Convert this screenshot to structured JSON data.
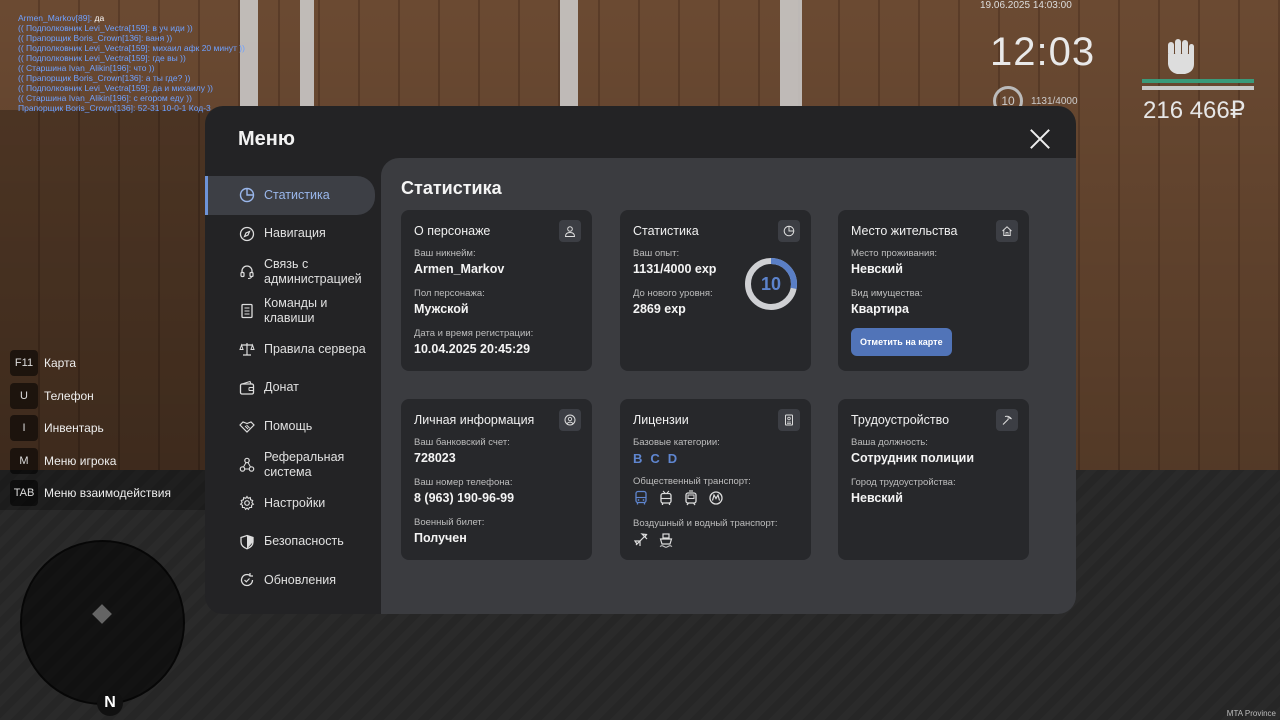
{
  "chat": [
    {
      "name": "Armen_Markov[89]:",
      "text": " да"
    },
    {
      "name": "(( Подполковник Levi_Vectra[159]:",
      "text": " в уч иди ))"
    },
    {
      "name": "(( Прапорщик Boris_Crown[136]:",
      "text": " ваня ))"
    },
    {
      "name": "(( Подполковник Levi_Vectra[159]:",
      "text": " михаил афк 20 минут ))"
    },
    {
      "name": "(( Подполковник Levi_Vectra[159]:",
      "text": " где вы ))"
    },
    {
      "name": "(( Старшина Ivan_Alikin[196]:",
      "text": " что ))"
    },
    {
      "name": "(( Прапорщик Boris_Crown[136]:",
      "text": " а ты где? ))"
    },
    {
      "name": "(( Подполковник Levi_Vectra[159]:",
      "text": " да и михаилу ))"
    },
    {
      "name": "(( Старшина Ivan_Alikin[196]:",
      "text": " с егором еду ))"
    },
    {
      "name": "Прапорщик Boris_Crown[136]:",
      "text": " 52-31 10-0-1 Код-3"
    }
  ],
  "hud": {
    "date": "19.06.2025 14:03:00",
    "time": "12:03",
    "level": "10",
    "exp": "1131/4000",
    "money": "216 466₽"
  },
  "binds": [
    {
      "key": "F11",
      "label": "Карта"
    },
    {
      "key": "U",
      "label": "Телефон"
    },
    {
      "key": "I",
      "label": "Инвентарь"
    },
    {
      "key": "M",
      "label": "Меню игрока"
    },
    {
      "key": "TAB",
      "label": "Меню взаимодействия"
    }
  ],
  "minimap": {
    "north": "N"
  },
  "watermark": "MTA Province",
  "menu": {
    "title": "Меню",
    "sidebar": [
      {
        "label": "Статистика",
        "icon": "pie-chart-icon"
      },
      {
        "label": "Навигация",
        "icon": "compass-icon"
      },
      {
        "label": "Связь с администрацией",
        "icon": "headset-icon"
      },
      {
        "label": "Команды и клавиши",
        "icon": "document-icon"
      },
      {
        "label": "Правила сервера",
        "icon": "scales-icon"
      },
      {
        "label": "Донат",
        "icon": "wallet-icon"
      },
      {
        "label": "Помощь",
        "icon": "handshake-icon"
      },
      {
        "label": "Реферальная система",
        "icon": "network-icon"
      },
      {
        "label": "Настройки",
        "icon": "gear-icon"
      },
      {
        "label": "Безопасность",
        "icon": "shield-icon"
      },
      {
        "label": "Обновления",
        "icon": "refresh-icon"
      }
    ],
    "content_title": "Статистика",
    "character": {
      "title": "О персонаже",
      "nick_label": "Ваш никнейм:",
      "nick": "Armen_Markov",
      "gender_label": "Пол персонажа:",
      "gender": "Мужской",
      "reg_label": "Дата и время регистрации:",
      "reg": "10.04.2025 20:45:29"
    },
    "stats": {
      "title": "Статистика",
      "exp_label": "Ваш опыт:",
      "exp": "1131/4000 exp",
      "next_label": "До нового уровня:",
      "next": "2869 exp",
      "level": "10",
      "progress": 0.28
    },
    "residence": {
      "title": "Место жительства",
      "place_label": "Место проживания:",
      "place": "Невский",
      "type_label": "Вид имущества:",
      "type": "Квартира",
      "button": "Отметить на карте"
    },
    "personal": {
      "title": "Личная информация",
      "bank_label": "Ваш банковский счет:",
      "bank": "728023",
      "phone_label": "Ваш номер телефона:",
      "phone": "8 (963) 190-96-99",
      "military_label": "Военный билет:",
      "military": "Получен"
    },
    "licenses": {
      "title": "Лицензии",
      "base_label": "Базовые категории:",
      "base": [
        "B",
        "C",
        "D"
      ],
      "public_label": "Общественный транспорт:",
      "air_label": "Воздушный и водный транспорт:"
    },
    "employment": {
      "title": "Трудоустройство",
      "position_label": "Ваша должность:",
      "position": "Сотрудник полиции",
      "city_label": "Город трудоустройства:",
      "city": "Невский"
    }
  }
}
